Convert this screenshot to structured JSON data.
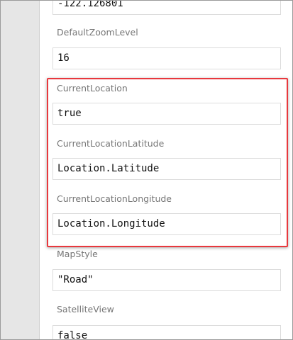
{
  "fields": [
    {
      "label": "",
      "value": "-122.126801"
    },
    {
      "label": "DefaultZoomLevel",
      "value": "16"
    },
    {
      "label": "CurrentLocation",
      "value": "true"
    },
    {
      "label": "CurrentLocationLatitude",
      "value": "Location.Latitude"
    },
    {
      "label": "CurrentLocationLongitude",
      "value": "Location.Longitude"
    },
    {
      "label": "MapStyle",
      "value": "\"Road\""
    },
    {
      "label": "SatelliteView",
      "value": "false"
    }
  ],
  "highlight_color": "#e8383d"
}
